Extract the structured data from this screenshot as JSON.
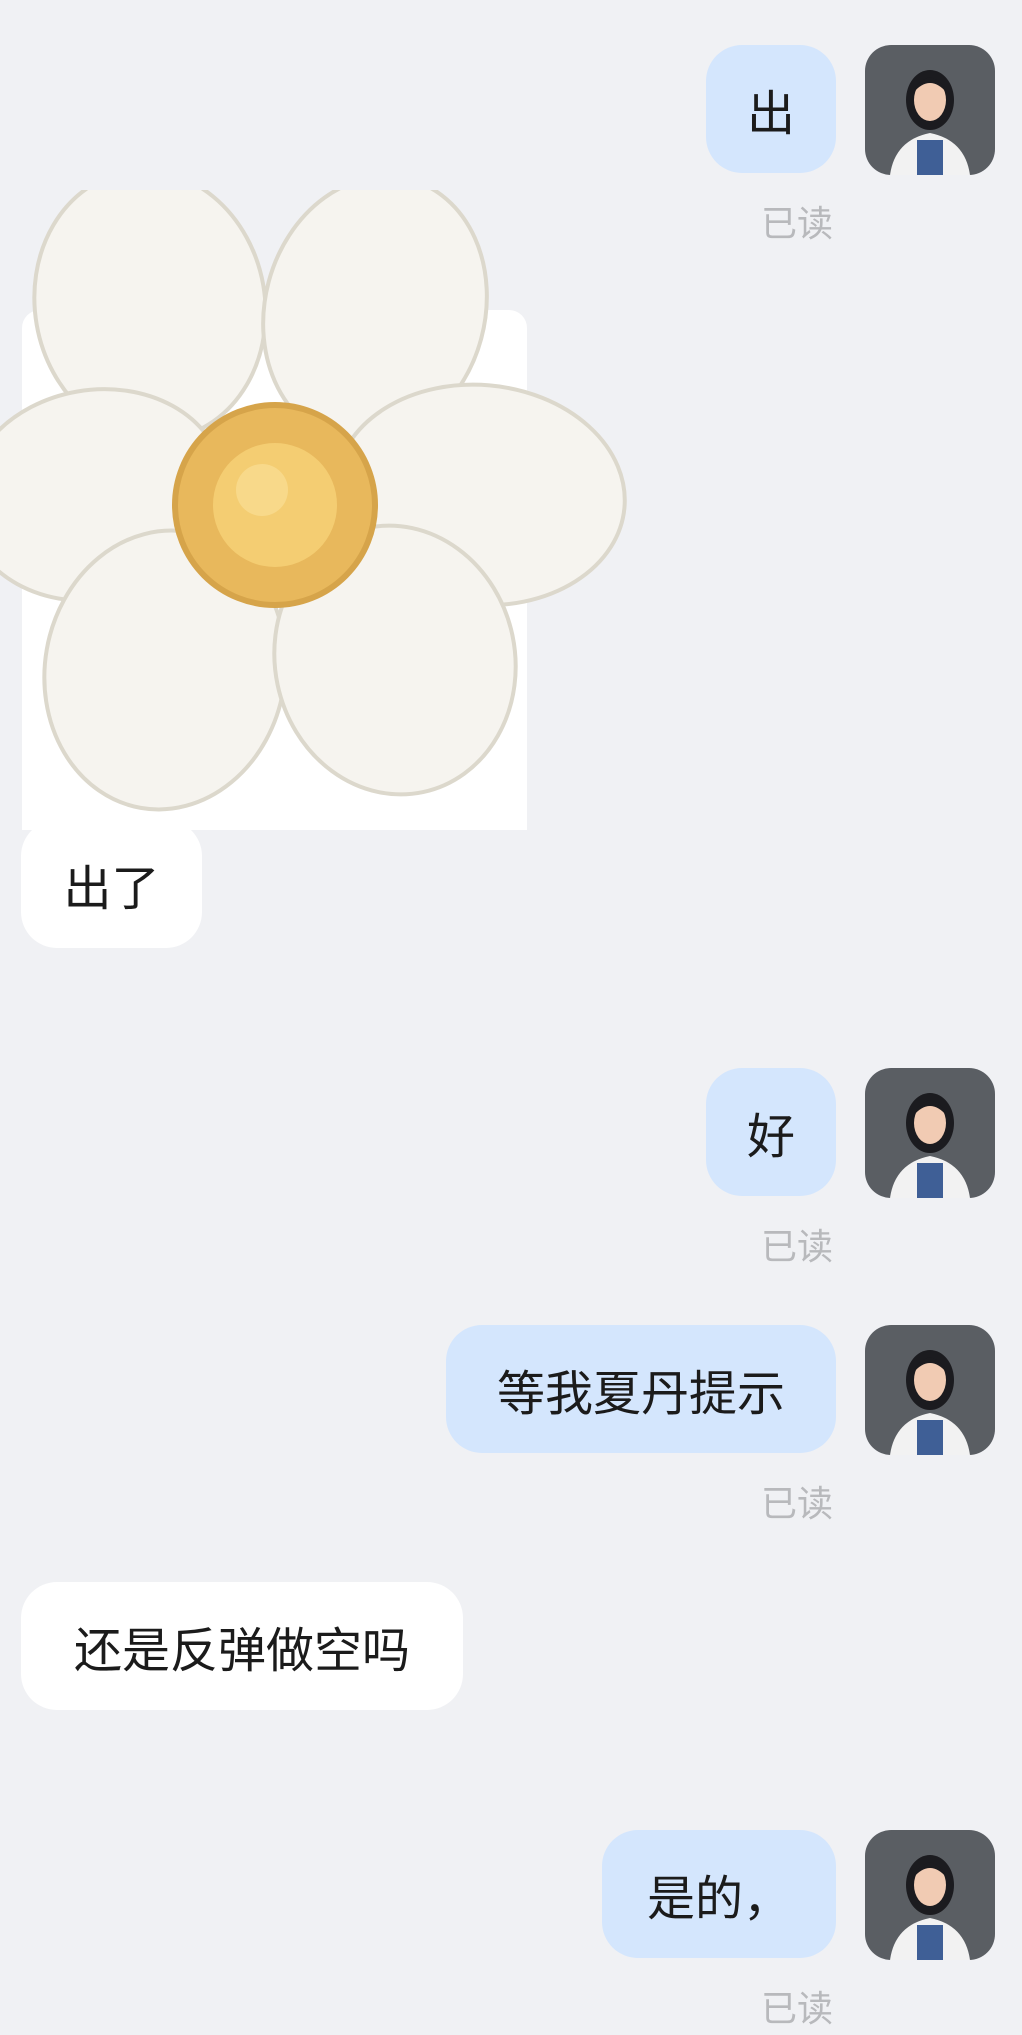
{
  "conversation": {
    "messages": [
      {
        "side": "out",
        "text": "出",
        "status": "已读"
      },
      {
        "side": "in",
        "type": "sticker",
        "sticker": "white-daisy-flower-sticker"
      },
      {
        "side": "in",
        "text": "出了"
      },
      {
        "side": "out",
        "text": "好",
        "status": "已读"
      },
      {
        "side": "out",
        "text": "等我夏丹提示",
        "status": "已读"
      },
      {
        "side": "in",
        "text": "还是反弹做空吗"
      },
      {
        "side": "out",
        "text": "是的，",
        "status": "已读"
      }
    ]
  },
  "colors": {
    "background": "#f0f1f4",
    "outgoing_bubble": "#d4e6fd",
    "incoming_bubble": "#ffffff",
    "read_status": "#b8b9bc"
  }
}
